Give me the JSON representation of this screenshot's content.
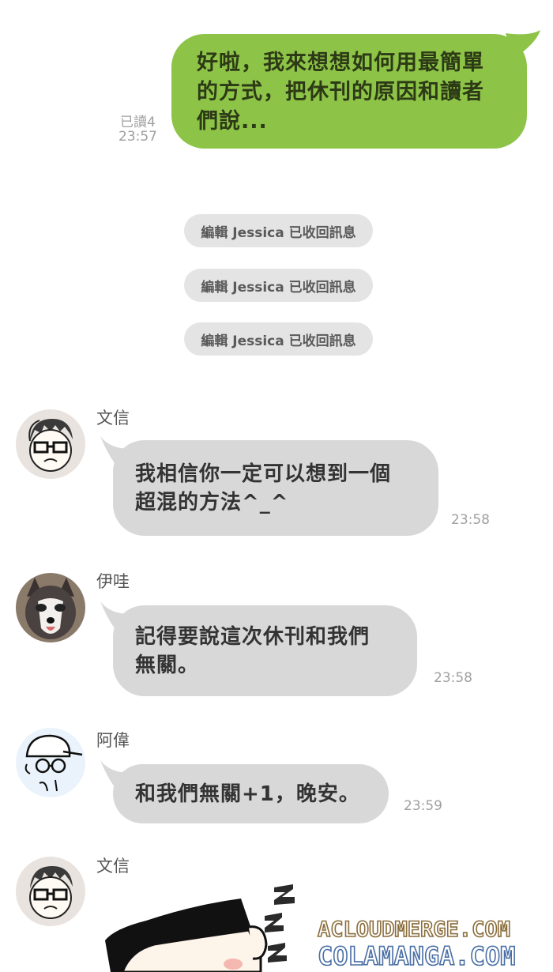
{
  "outgoing": {
    "text": "好啦，我來想想如何用最簡單\n的方式，把休刊的原因和讀者\n們說...",
    "read": "已讀4",
    "time": "23:57"
  },
  "notices": [
    "編輯 Jessica 已收回訊息",
    "編輯 Jessica 已收回訊息",
    "編輯 Jessica 已收回訊息"
  ],
  "messages": [
    {
      "sender": "文信",
      "text": "我相信你一定可以想到一個\n超混的方法^_^",
      "time": "23:58"
    },
    {
      "sender": "伊哇",
      "text": "記得要說這次休刊和我們\n無關。",
      "time": "23:58"
    },
    {
      "sender": "阿偉",
      "text": "和我們無關+1，晚安。",
      "time": "23:59"
    },
    {
      "sender": "文信"
    }
  ],
  "sticker": {
    "sleep_letters": "ZZZ"
  },
  "watermark": {
    "line1": "ACLOUDMERGE.COM",
    "line2": "COLAMANGA.COM"
  },
  "colors": {
    "outgoing_bubble": "#8dc448",
    "incoming_bubble": "#d8d8d8",
    "notice_bg": "#e4e4e4",
    "watermark_fill": "#ffffff",
    "watermark_stroke": "#8a6d3b"
  }
}
